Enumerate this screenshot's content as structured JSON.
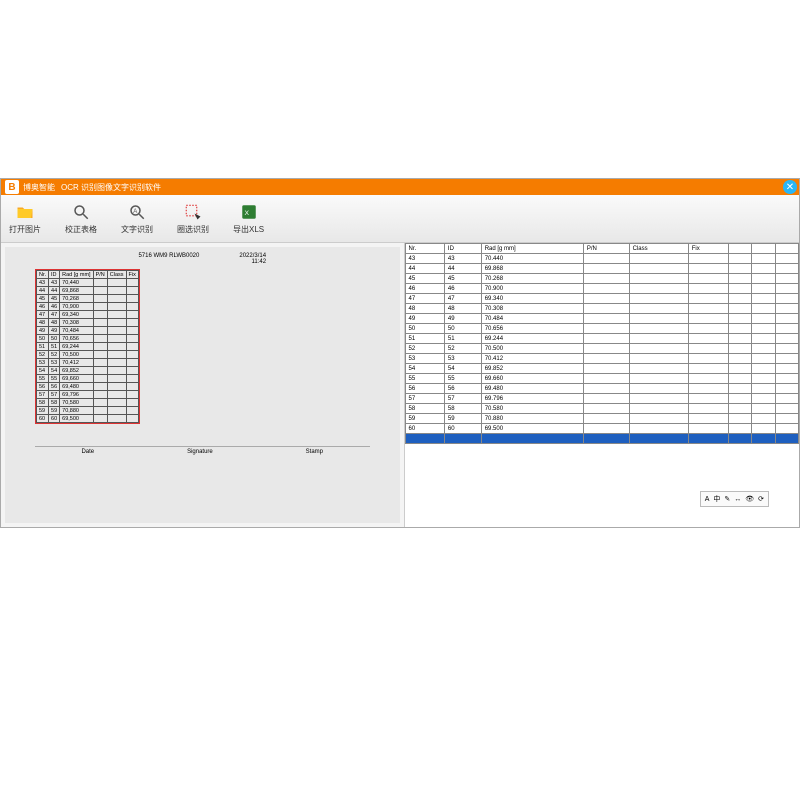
{
  "titlebar": {
    "brand": "博奥智能",
    "title": "OCR 识别图像文字识别软件"
  },
  "toolbar": {
    "open": "打开图片",
    "correct": "校正表格",
    "ocr_text": "文字识别",
    "ocr_area": "圈选识别",
    "export": "导出XLS"
  },
  "doc": {
    "code": "5716 WM9 RLWB0020",
    "date": "2022/3/14",
    "time": "11:42",
    "footer_date": "Date",
    "footer_sig": "Signature",
    "footer_stamp": "Stamp",
    "headers": [
      "Nr.",
      "ID",
      "Rad [g mm]",
      "P/N",
      "Class",
      "Fix"
    ],
    "rows": [
      {
        "nr": "43",
        "id": "43",
        "rad": "70,440"
      },
      {
        "nr": "44",
        "id": "44",
        "rad": "69,868"
      },
      {
        "nr": "45",
        "id": "45",
        "rad": "70,268"
      },
      {
        "nr": "46",
        "id": "46",
        "rad": "70,900"
      },
      {
        "nr": "47",
        "id": "47",
        "rad": "69,340"
      },
      {
        "nr": "48",
        "id": "48",
        "rad": "70,308"
      },
      {
        "nr": "49",
        "id": "49",
        "rad": "70,484"
      },
      {
        "nr": "50",
        "id": "50",
        "rad": "70,656"
      },
      {
        "nr": "51",
        "id": "51",
        "rad": "69,244"
      },
      {
        "nr": "52",
        "id": "52",
        "rad": "70,500"
      },
      {
        "nr": "53",
        "id": "53",
        "rad": "70,412"
      },
      {
        "nr": "54",
        "id": "54",
        "rad": "69,852"
      },
      {
        "nr": "55",
        "id": "55",
        "rad": "69,660"
      },
      {
        "nr": "56",
        "id": "56",
        "rad": "69,480"
      },
      {
        "nr": "57",
        "id": "57",
        "rad": "69,796"
      },
      {
        "nr": "58",
        "id": "58",
        "rad": "70,580"
      },
      {
        "nr": "59",
        "id": "59",
        "rad": "70,880"
      },
      {
        "nr": "60",
        "id": "60",
        "rad": "69,500"
      }
    ]
  },
  "grid": {
    "headers": [
      "Nr.",
      "ID",
      "Rad [g mm]",
      "P/N",
      "Class",
      "Fix"
    ],
    "rows": [
      {
        "nr": "43",
        "id": "43",
        "rad": "70.440"
      },
      {
        "nr": "44",
        "id": "44",
        "rad": "69.868"
      },
      {
        "nr": "45",
        "id": "45",
        "rad": "70.268"
      },
      {
        "nr": "46",
        "id": "46",
        "rad": "70.900"
      },
      {
        "nr": "47",
        "id": "47",
        "rad": "69.340"
      },
      {
        "nr": "48",
        "id": "48",
        "rad": "70.308"
      },
      {
        "nr": "49",
        "id": "49",
        "rad": "70.484"
      },
      {
        "nr": "50",
        "id": "50",
        "rad": "70.656"
      },
      {
        "nr": "51",
        "id": "51",
        "rad": "69.244"
      },
      {
        "nr": "52",
        "id": "52",
        "rad": "70.500"
      },
      {
        "nr": "53",
        "id": "53",
        "rad": "70.412"
      },
      {
        "nr": "54",
        "id": "54",
        "rad": "69.852"
      },
      {
        "nr": "55",
        "id": "55",
        "rad": "69.660"
      },
      {
        "nr": "56",
        "id": "56",
        "rad": "69.480"
      },
      {
        "nr": "57",
        "id": "57",
        "rad": "69.796"
      },
      {
        "nr": "58",
        "id": "58",
        "rad": "70.580"
      },
      {
        "nr": "59",
        "id": "59",
        "rad": "70.880"
      },
      {
        "nr": "60",
        "id": "60",
        "rad": "69.500"
      }
    ]
  },
  "mini": {
    "a": "A",
    "zh": "中",
    "pen": "✎",
    "arrow": "↔",
    "eye": "👁",
    "refresh": "⟳"
  }
}
